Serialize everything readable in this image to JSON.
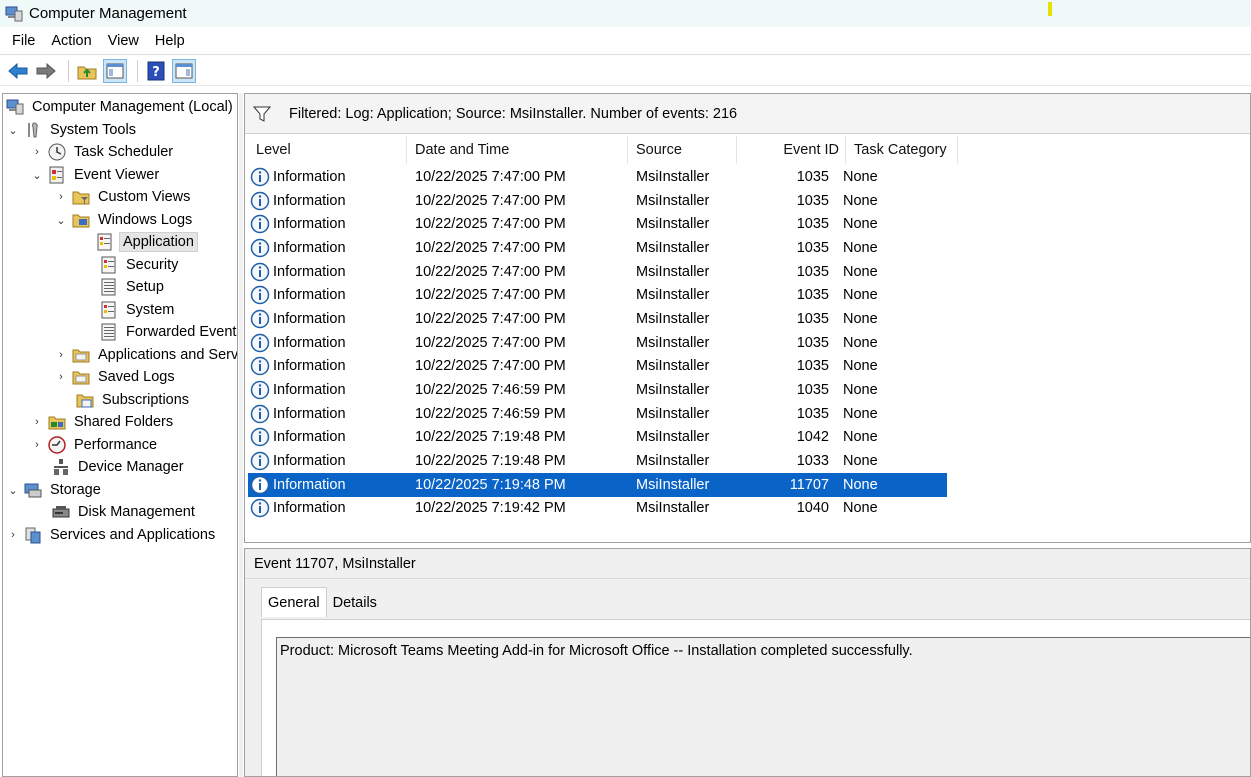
{
  "window": {
    "title": "Computer Management"
  },
  "menu": [
    "File",
    "Action",
    "View",
    "Help"
  ],
  "toolbar": [
    "back-icon",
    "forward-icon",
    "up-folder-icon",
    "show-hide-tree-icon",
    "help-icon",
    "show-action-pane-icon"
  ],
  "tree": {
    "root": "Computer Management (Local)",
    "system_tools": "System Tools",
    "task_scheduler": "Task Scheduler",
    "event_viewer": "Event Viewer",
    "custom_views": "Custom Views",
    "windows_logs": "Windows Logs",
    "application": "Application",
    "security": "Security",
    "setup": "Setup",
    "system": "System",
    "forwarded_events": "Forwarded Events",
    "apps_services_logs": "Applications and Services Logs",
    "saved_logs": "Saved Logs",
    "subscriptions": "Subscriptions",
    "shared_folders": "Shared Folders",
    "performance": "Performance",
    "device_manager": "Device Manager",
    "storage": "Storage",
    "disk_management": "Disk Management",
    "services_apps": "Services and Applications"
  },
  "filter": {
    "text": "Filtered: Log: Application; Source: MsiInstaller. Number of events: 216"
  },
  "columns": {
    "level": "Level",
    "date": "Date and Time",
    "source": "Source",
    "event_id": "Event ID",
    "task_category": "Task Category"
  },
  "events": [
    {
      "level": "Information",
      "date": "10/22/2025 7:47:00 PM",
      "source": "MsiInstaller",
      "event_id": "1035",
      "category": "None"
    },
    {
      "level": "Information",
      "date": "10/22/2025 7:47:00 PM",
      "source": "MsiInstaller",
      "event_id": "1035",
      "category": "None"
    },
    {
      "level": "Information",
      "date": "10/22/2025 7:47:00 PM",
      "source": "MsiInstaller",
      "event_id": "1035",
      "category": "None"
    },
    {
      "level": "Information",
      "date": "10/22/2025 7:47:00 PM",
      "source": "MsiInstaller",
      "event_id": "1035",
      "category": "None"
    },
    {
      "level": "Information",
      "date": "10/22/2025 7:47:00 PM",
      "source": "MsiInstaller",
      "event_id": "1035",
      "category": "None"
    },
    {
      "level": "Information",
      "date": "10/22/2025 7:47:00 PM",
      "source": "MsiInstaller",
      "event_id": "1035",
      "category": "None"
    },
    {
      "level": "Information",
      "date": "10/22/2025 7:47:00 PM",
      "source": "MsiInstaller",
      "event_id": "1035",
      "category": "None"
    },
    {
      "level": "Information",
      "date": "10/22/2025 7:47:00 PM",
      "source": "MsiInstaller",
      "event_id": "1035",
      "category": "None"
    },
    {
      "level": "Information",
      "date": "10/22/2025 7:47:00 PM",
      "source": "MsiInstaller",
      "event_id": "1035",
      "category": "None"
    },
    {
      "level": "Information",
      "date": "10/22/2025 7:46:59 PM",
      "source": "MsiInstaller",
      "event_id": "1035",
      "category": "None"
    },
    {
      "level": "Information",
      "date": "10/22/2025 7:46:59 PM",
      "source": "MsiInstaller",
      "event_id": "1035",
      "category": "None"
    },
    {
      "level": "Information",
      "date": "10/22/2025 7:19:48 PM",
      "source": "MsiInstaller",
      "event_id": "1042",
      "category": "None"
    },
    {
      "level": "Information",
      "date": "10/22/2025 7:19:48 PM",
      "source": "MsiInstaller",
      "event_id": "1033",
      "category": "None"
    },
    {
      "level": "Information",
      "date": "10/22/2025 7:19:48 PM",
      "source": "MsiInstaller",
      "event_id": "11707",
      "category": "None",
      "selected": true
    },
    {
      "level": "Information",
      "date": "10/22/2025 7:19:42 PM",
      "source": "MsiInstaller",
      "event_id": "1040",
      "category": "None"
    }
  ],
  "detail": {
    "title": "Event 11707, MsiInstaller",
    "tab_general": "General",
    "tab_details": "Details",
    "description": "Product: Microsoft Teams Meeting Add-in for Microsoft Office -- Installation completed successfully."
  },
  "colors": {
    "selection": "#0a64c8",
    "info_icon": "#1f5fa8",
    "titlebar_bg": "#eef9f8"
  }
}
